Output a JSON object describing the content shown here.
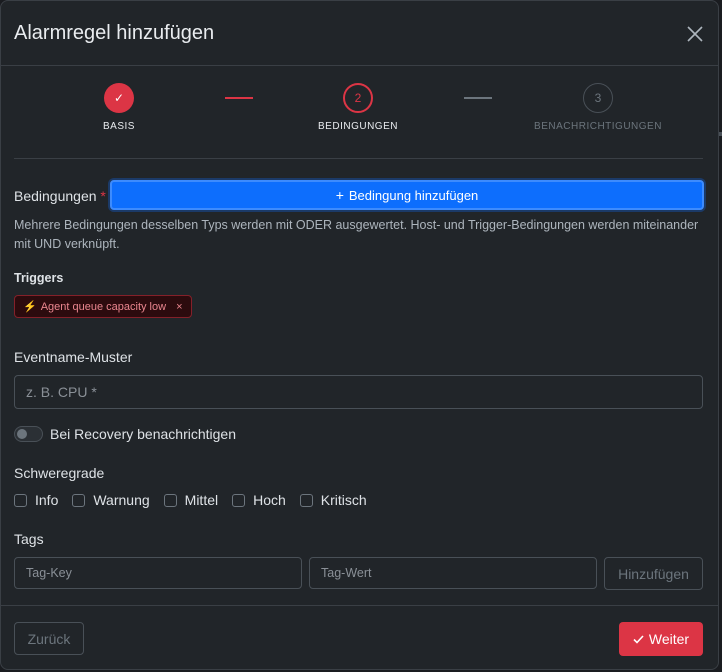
{
  "modal": {
    "title": "Alarmregel hinzufügen"
  },
  "stepper": {
    "steps": [
      {
        "label": "BASIS",
        "state": "done",
        "glyph": "✓"
      },
      {
        "label": "BEDINGUNGEN",
        "state": "active",
        "number": "2"
      },
      {
        "label": "BENACHRICHTIGUNGEN",
        "state": "pending",
        "number": "3"
      }
    ]
  },
  "conditions": {
    "label": "Bedingungen",
    "required_marker": "*",
    "add_button_label": "Bedingung hinzufügen",
    "help_text": "Mehrere Bedingungen desselben Typs werden mit ODER ausgewertet. Host- und Trigger-Bedingungen werden miteinander mit UND verknüpft."
  },
  "triggers": {
    "heading": "Triggers",
    "items": [
      {
        "label": "Agent queue capacity low",
        "remove_glyph": "×"
      }
    ]
  },
  "event_pattern": {
    "label": "Eventname-Muster",
    "value": "",
    "placeholder": "z. B. CPU *"
  },
  "recovery": {
    "label": "Bei Recovery benachrichtigen",
    "checked": false
  },
  "severity": {
    "label": "Schweregrade",
    "options": [
      {
        "label": "Info",
        "checked": false
      },
      {
        "label": "Warnung",
        "checked": false
      },
      {
        "label": "Mittel",
        "checked": false
      },
      {
        "label": "Hoch",
        "checked": false
      },
      {
        "label": "Kritisch",
        "checked": false
      }
    ]
  },
  "tags": {
    "label": "Tags",
    "key_placeholder": "Tag-Key",
    "value_placeholder": "Tag-Wert",
    "add_button_label": "Hinzufügen"
  },
  "footer": {
    "back_label": "Zurück",
    "next_label": "Weiter"
  },
  "colors": {
    "accent": "#dc3545",
    "primary": "#0d6efd",
    "background": "#212529"
  }
}
